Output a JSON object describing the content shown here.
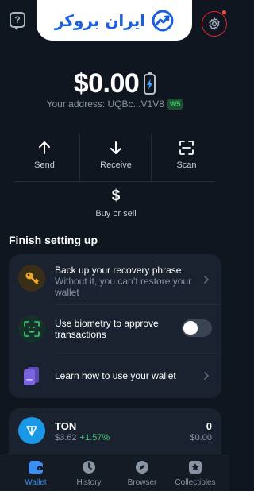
{
  "header": {
    "help_icon": "question-bubble-icon",
    "brand_name": "ایران بروکر",
    "brand_icon": "chart-trend-icon",
    "settings_icon": "gear-icon",
    "brand_color": "#1a5fe0"
  },
  "balance": {
    "amount": "$0.00",
    "battery_icon": "battery-bolt-icon",
    "address_label": "Your address: UQBc...V1V8",
    "wallet_version": "W5"
  },
  "actions": [
    {
      "label": "Send",
      "icon": "arrow-up-icon"
    },
    {
      "label": "Receive",
      "icon": "arrow-down-icon"
    },
    {
      "label": "Scan",
      "icon": "scan-icon"
    },
    {
      "label": "Buy or sell",
      "icon": "dollar-icon"
    }
  ],
  "setup": {
    "title": "Finish setting up",
    "items": [
      {
        "title": "Back up your recovery phrase",
        "subtitle": "Without it, you can’t restore your wallet",
        "icon": "key-icon"
      },
      {
        "title": "Use biometry to approve transactions",
        "subtitle": "",
        "icon": "face-scan-icon",
        "toggle_on": false
      },
      {
        "title": "Learn how to use your wallet",
        "subtitle": "",
        "icon": "cards-icon"
      }
    ]
  },
  "tokens": [
    {
      "name": "TON",
      "price": "$3.62",
      "change": "+1.57%",
      "amount": "0",
      "fiat": "$0.00",
      "icon": "ton-icon"
    }
  ],
  "tabs": [
    {
      "label": "Wallet",
      "icon": "wallet-icon",
      "active": true
    },
    {
      "label": "History",
      "icon": "clock-icon",
      "active": false
    },
    {
      "label": "Browser",
      "icon": "compass-icon",
      "active": false
    },
    {
      "label": "Collectibles",
      "icon": "star-box-icon",
      "active": false
    }
  ],
  "colors": {
    "background": "#10161f",
    "card": "#1a222f",
    "accent": "#3d8ff2",
    "positive": "#3fcf72",
    "key_icon": "#f2a92b",
    "cards_icon": "#7b63e0"
  }
}
